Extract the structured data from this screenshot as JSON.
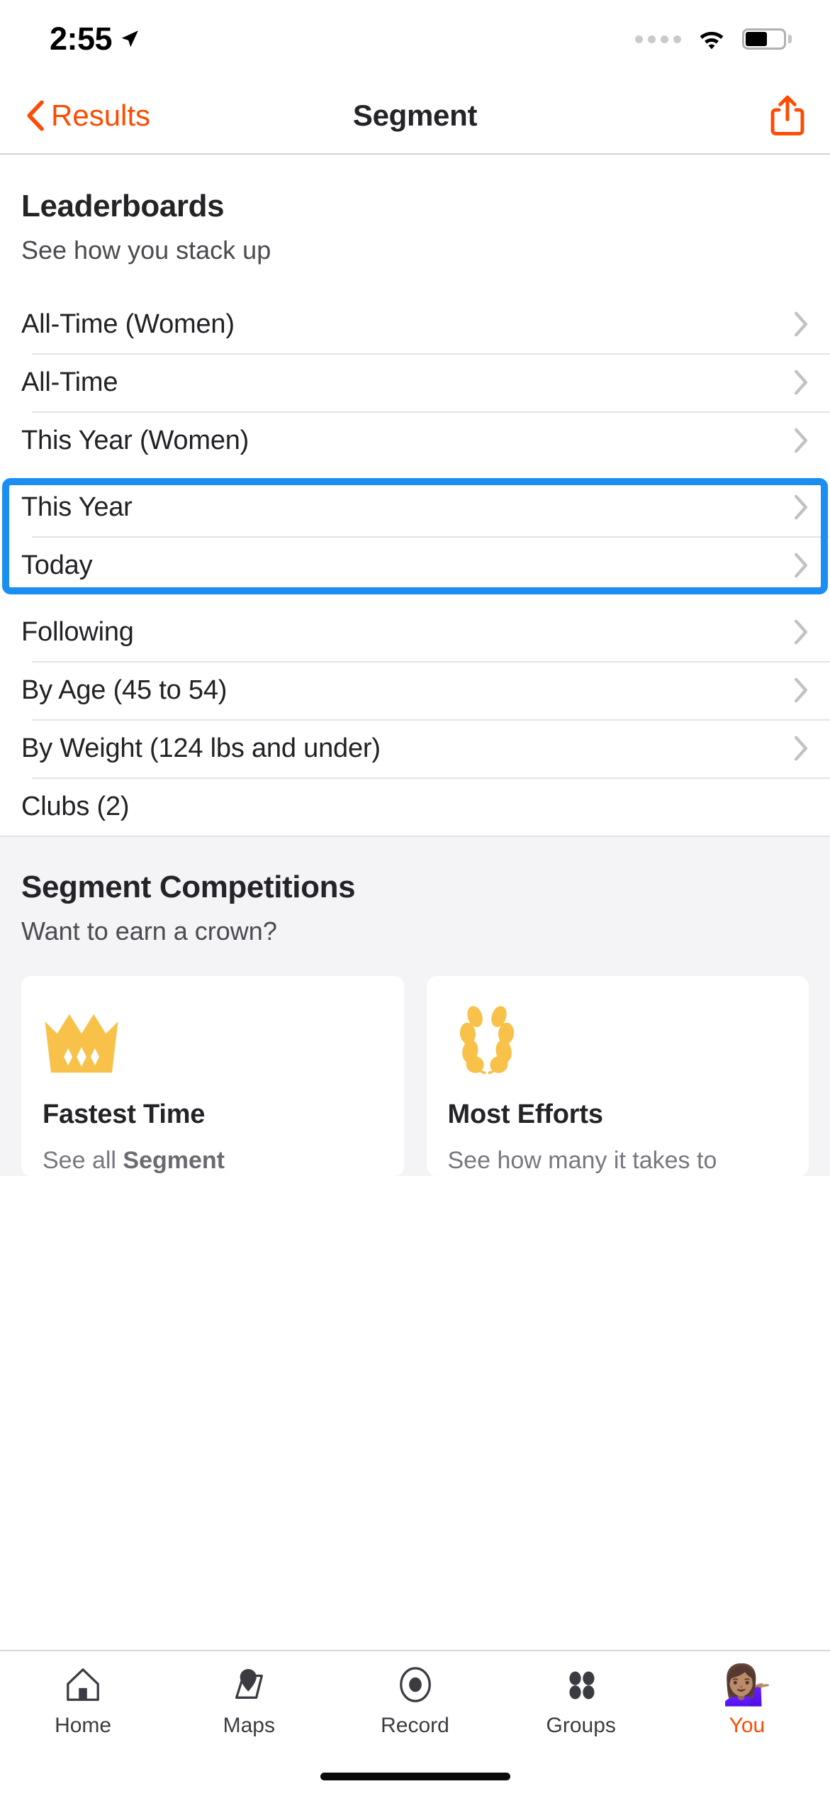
{
  "status_bar": {
    "time": "2:55",
    "location_icon": "location-arrow-icon",
    "signal_icon": "signal-dots-icon",
    "wifi_icon": "wifi-icon",
    "battery_icon": "battery-icon"
  },
  "nav": {
    "back_label": "Results",
    "back_icon": "chevron-left-icon",
    "title": "Segment",
    "share_icon": "share-icon",
    "accent_color": "#fc4c02"
  },
  "leaderboards": {
    "title": "Leaderboards",
    "subtitle": "See how you stack up",
    "rows": [
      {
        "label": "All-Time (Women)",
        "chevron": true
      },
      {
        "label": "All-Time",
        "chevron": true
      },
      {
        "label": "This Year (Women)",
        "chevron": true
      },
      {
        "label": "This Year",
        "chevron": true
      },
      {
        "label": "Today",
        "chevron": true
      },
      {
        "label": "Following",
        "chevron": true
      },
      {
        "label": "By Age (45 to 54)",
        "chevron": true
      },
      {
        "label": "By Weight (124 lbs and under)",
        "chevron": true
      },
      {
        "label": "Clubs (2)",
        "chevron": false
      }
    ],
    "highlight": {
      "color": "#1b8ef2",
      "from_row": 3,
      "to_row": 4
    }
  },
  "competitions": {
    "title": "Segment Competitions",
    "subtitle": "Want to earn a crown?",
    "cards": [
      {
        "icon": "crown-icon",
        "title": "Fastest Time",
        "desc_lead": "See all ",
        "desc_bold": "Segment"
      },
      {
        "icon": "laurel-wreath-icon",
        "title": "Most Efforts",
        "desc_lead": "See how many it takes to",
        "desc_bold": ""
      }
    ],
    "icon_color": "#f8c14a"
  },
  "tabbar": {
    "items": [
      {
        "label": "Home",
        "icon": "home-icon",
        "active": false
      },
      {
        "label": "Maps",
        "icon": "map-pin-icon",
        "active": false
      },
      {
        "label": "Record",
        "icon": "record-icon",
        "active": false
      },
      {
        "label": "Groups",
        "icon": "groups-icon",
        "active": false
      },
      {
        "label": "You",
        "icon": "avatar-icon",
        "active": true
      }
    ],
    "avatar_glyph": "💁🏽‍♀️",
    "active_color": "#fc4c02"
  }
}
